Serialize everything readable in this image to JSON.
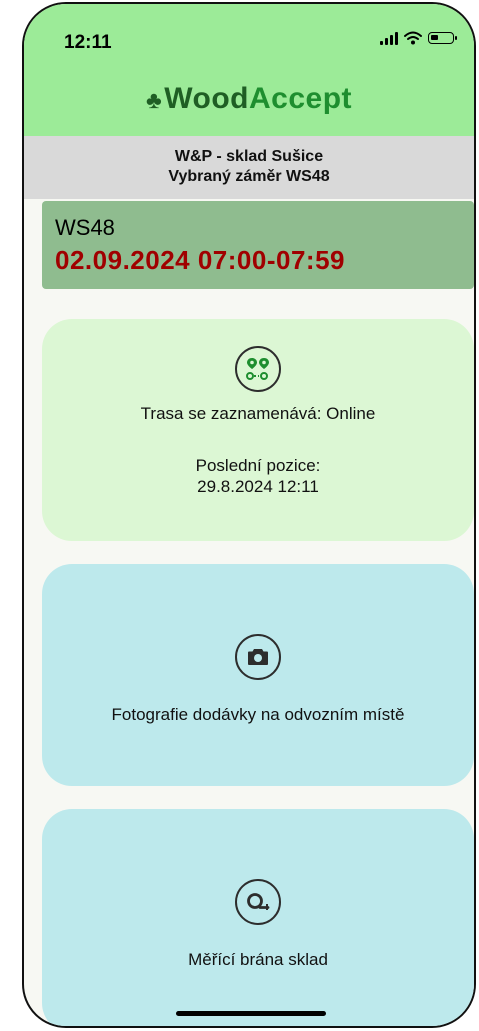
{
  "status_bar": {
    "time": "12:11"
  },
  "app": {
    "logo_prefix": "Wood",
    "logo_accent": "Accept",
    "brand_color": "#1f5e24",
    "header_color": "#9ceb98"
  },
  "site": {
    "line1": "W&P - sklad Sušice",
    "line2": "Vybraný záměr WS48"
  },
  "plan": {
    "code": "WS48",
    "datetime": "02.09.2024 07:00-07:59",
    "date_color": "#a00000"
  },
  "route_card": {
    "icon": "route-icon",
    "status_label": "Trasa se zaznamenává: Online",
    "last_position_label": "Poslední pozice:",
    "last_position_time": "29.8.2024 12:11"
  },
  "photo_card": {
    "icon": "camera-icon",
    "label": "Fotografie dodávky na odvozním místě"
  },
  "gate_card": {
    "icon": "measure-tape-icon",
    "label": "Měřící brána sklad"
  }
}
